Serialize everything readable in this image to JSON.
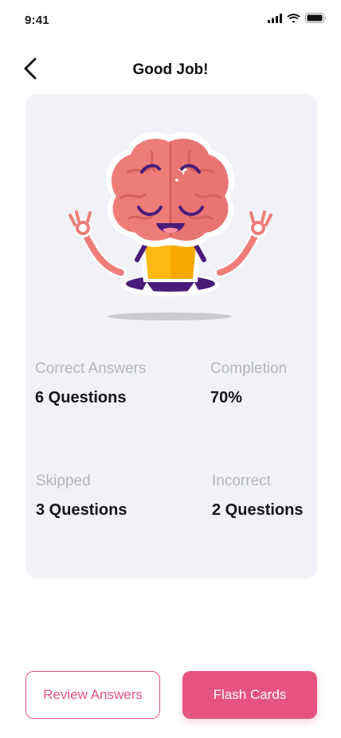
{
  "status_bar": {
    "time": "9:41",
    "icons": [
      "cellular-signal-icon",
      "wifi-icon",
      "battery-icon"
    ]
  },
  "header": {
    "title": "Good Job!",
    "back_icon": "chevron-left-icon"
  },
  "illustration": {
    "icon": "meditating-brain-mascot"
  },
  "stats": [
    {
      "label": "Correct Answers",
      "value": "6 Questions"
    },
    {
      "label": "Completion",
      "value": "70%"
    },
    {
      "label": "Skipped",
      "value": "3 Questions"
    },
    {
      "label": "Incorrect",
      "value": "2 Questions"
    }
  ],
  "actions": {
    "review_label": "Review Answers",
    "flash_label": "Flash Cards"
  },
  "colors": {
    "accent": "#e4547e",
    "card_background": "#f0f2f7",
    "label_gray": "#b3b5bb",
    "brain_pink": "#ee7d78",
    "shirt_yellow": "#f5a800",
    "pants_purple": "#4a1c7a"
  }
}
